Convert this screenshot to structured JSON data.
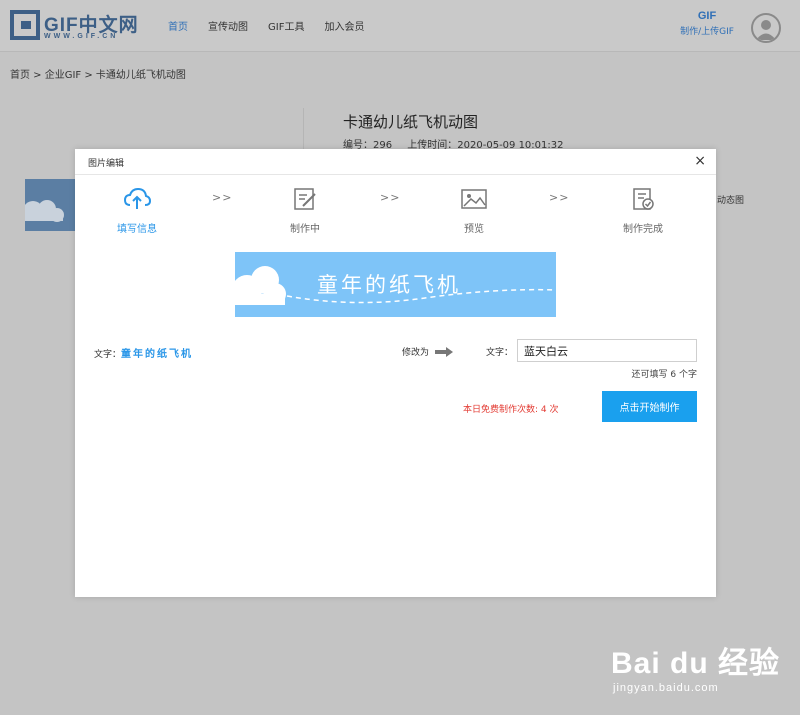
{
  "header": {
    "logo_text": "GIF中文网",
    "logo_sub": "WWW.GIF.CN",
    "nav": [
      "首页",
      "宣传动图",
      "GIF工具",
      "加入会员"
    ],
    "make_upload_badge": "GIF",
    "make_upload_label": "制作/上传GIF"
  },
  "breadcrumb": "首页 > 企业GIF > 卡通幼儿纸飞机动图",
  "detail": {
    "title": "卡通幼儿纸飞机动图",
    "id_label": "编号：296",
    "upload_time": "上传时间：2020-05-09 10:01:32",
    "side_text": "动态图"
  },
  "modal": {
    "title": "图片编辑",
    "close": "×",
    "steps": [
      {
        "label": "填写信息",
        "icon": "cloud-upload-icon"
      },
      {
        "label": "制作中",
        "icon": "edit-document-icon"
      },
      {
        "label": "预览",
        "icon": "image-preview-icon"
      },
      {
        "label": "制作完成",
        "icon": "document-check-icon"
      }
    ],
    "arrow_glyph": ">>",
    "banner_text": "童年的纸飞机",
    "text_label": "文字：",
    "original_text": "童年的纸飞机",
    "modify_label": "修改为",
    "input_label": "文字：",
    "input_value": "蓝天白云",
    "remaining": "还可填写 6 个字",
    "quota": "本日免费制作次数: 4 次",
    "start_button": "点击开始制作"
  },
  "watermark": {
    "main": "Bai du 经验",
    "sub": "jingyan.baidu.com"
  },
  "colors": {
    "accent": "#2a96e8",
    "button": "#1aa0ee",
    "banner": "#7ec4f8",
    "quota": "#e33b33"
  }
}
